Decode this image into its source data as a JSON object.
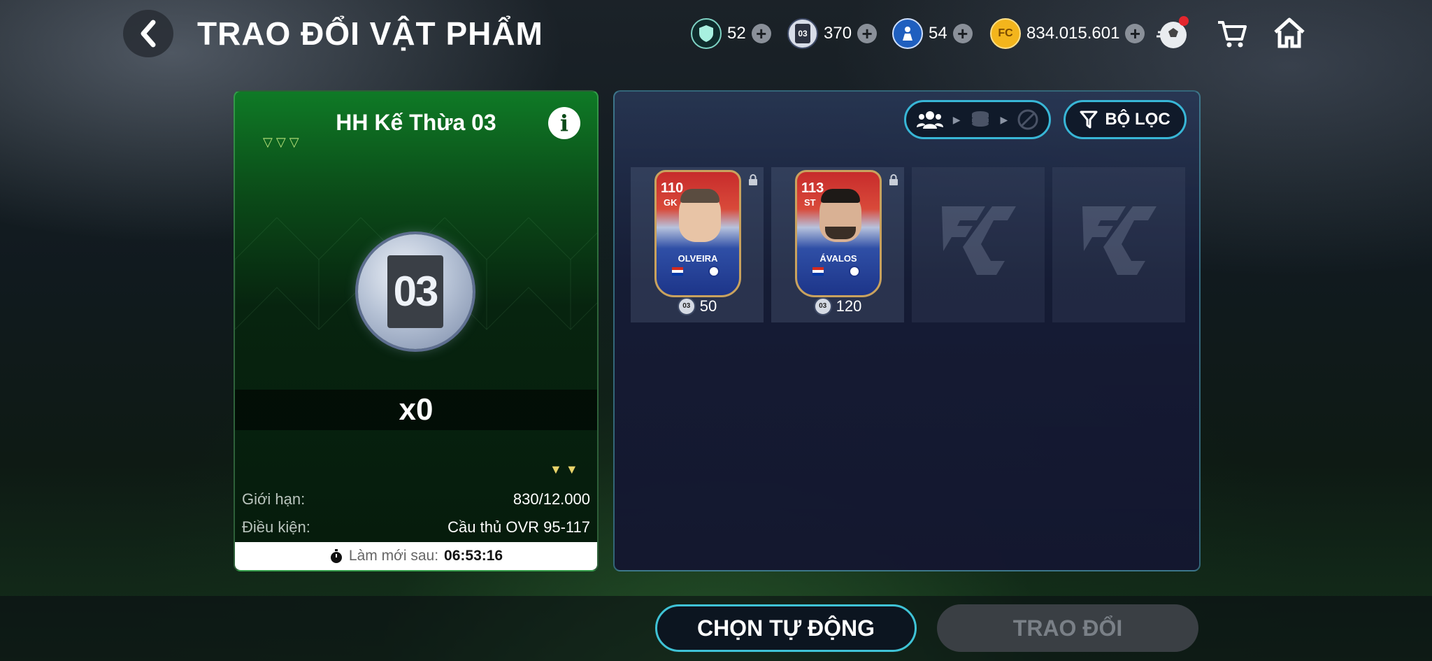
{
  "header": {
    "title": "TRAO ĐỔI VẬT PHẨM",
    "back_icon": "chevron-left-icon",
    "currencies": [
      {
        "icon": "shield-token-icon",
        "value": "52"
      },
      {
        "icon": "card-03-token-icon",
        "value": "370"
      },
      {
        "icon": "player-token-icon",
        "value": "54"
      },
      {
        "icon": "fc-coin-icon",
        "value": "834.015.601"
      }
    ],
    "icons": [
      "ball-menu-icon",
      "cart-icon",
      "home-icon"
    ]
  },
  "left_card": {
    "title": "HH Kế Thừa 03",
    "medal_label": "03",
    "quantity": "x0",
    "limit_label": "Giới hạn:",
    "limit_value": "830/12.000",
    "condition_label": "Điều kiện:",
    "condition_value": "Cầu thủ OVR 95-117",
    "refresh_label": "Làm mới sau:",
    "refresh_time": "06:53:16"
  },
  "right_panel": {
    "filter_label": "BỘ LỌC",
    "players": [
      {
        "ovr": "110",
        "position": "GK",
        "name": "OLVEIRA",
        "cost": "50",
        "cost_icon_label": "03"
      },
      {
        "ovr": "113",
        "position": "ST",
        "name": "ÁVALOS",
        "cost": "120",
        "cost_icon_label": "03"
      }
    ]
  },
  "buttons": {
    "auto_select": "CHỌN TỰ ĐỘNG",
    "trade": "TRAO ĐỔI"
  },
  "colors": {
    "accent_cyan": "#3fc3d6",
    "green_card": "#0f7a26",
    "coin_gold": "#f3b51c",
    "notification_red": "#e3262d"
  }
}
